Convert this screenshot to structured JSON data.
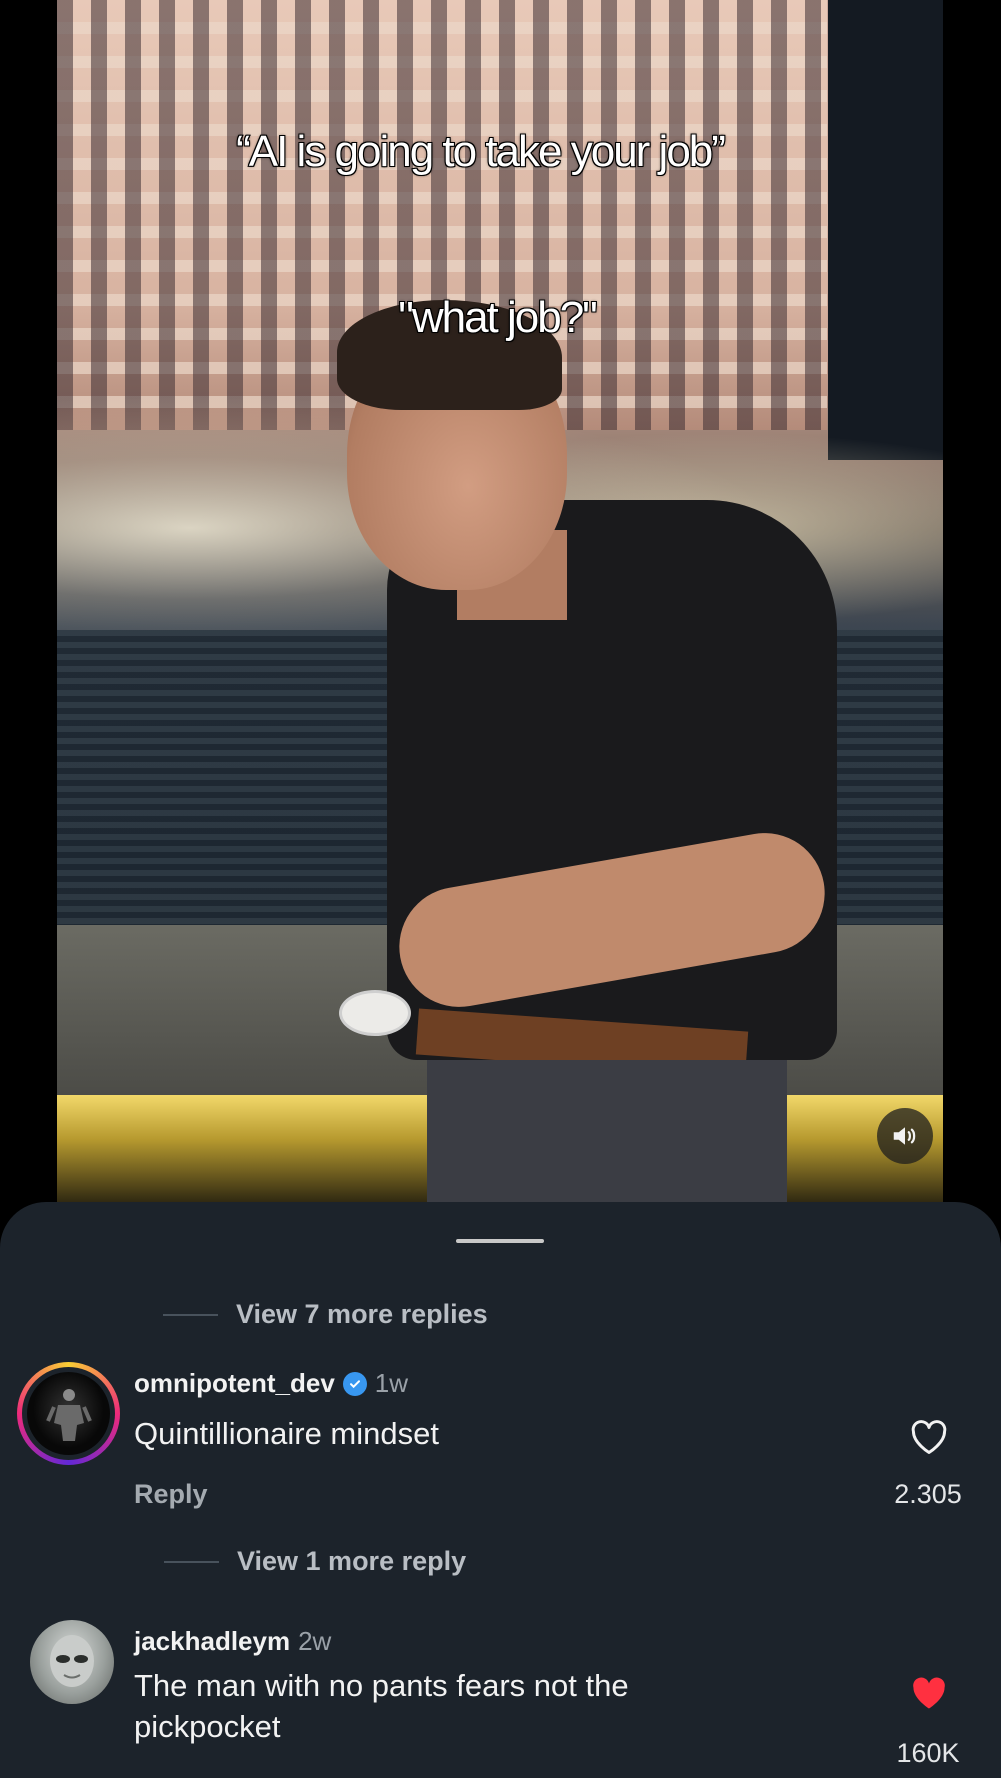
{
  "video": {
    "caption_top": "“AI is going to take your job”",
    "caption_bottom": "\"what job?\"",
    "mute_icon": "speaker-muted-icon"
  },
  "comments_sheet": {
    "view_more_replies": "View 7 more replies",
    "comments": [
      {
        "username": "omnipotent_dev",
        "verified": true,
        "time": "1w",
        "text": "Quintillionaire mindset",
        "reply_label": "Reply",
        "likes": "2.305",
        "liked": false,
        "view_replies": "View 1 more reply",
        "avatar_icon": "profile-photo",
        "like_icon": "heart-outline-icon"
      },
      {
        "username": "jackhadleym",
        "verified": false,
        "time": "2w",
        "text": "The man with no pants fears not the pickpocket",
        "likes": "160K",
        "liked": true,
        "avatar_icon": "profile-photo",
        "like_icon": "heart-filled-icon"
      }
    ]
  },
  "colors": {
    "sheet_bg": "#1c232b",
    "verified_blue": "#3897f0",
    "like_red": "#ff3040",
    "story_ring": [
      "#f9ce34",
      "#ee2a7b",
      "#6228d7"
    ]
  }
}
